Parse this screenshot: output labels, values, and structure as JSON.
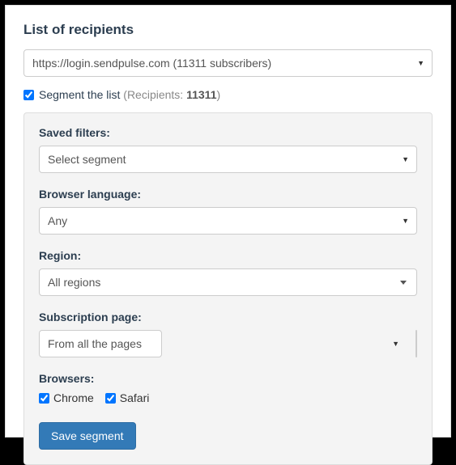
{
  "title": "List of recipients",
  "recipientSelect": {
    "selected": "https://login.sendpulse.com (11311 subscribers)"
  },
  "segmentCheckbox": {
    "checked": true,
    "label": "Segment the list",
    "recipientsPrefix": "(Recipients: ",
    "recipientsCount": "11311",
    "recipientsSuffix": ")"
  },
  "filters": {
    "savedFilters": {
      "label": "Saved filters:",
      "selected": "Select segment"
    },
    "browserLanguage": {
      "label": "Browser language:",
      "selected": "Any"
    },
    "region": {
      "label": "Region:",
      "selected": "All regions"
    },
    "subscriptionPage": {
      "label": "Subscription page:",
      "selected": "From all the pages"
    },
    "browsers": {
      "label": "Browsers:",
      "options": {
        "chrome": {
          "label": "Chrome",
          "checked": true
        },
        "safari": {
          "label": "Safari",
          "checked": true
        }
      }
    }
  },
  "saveButton": "Save segment"
}
